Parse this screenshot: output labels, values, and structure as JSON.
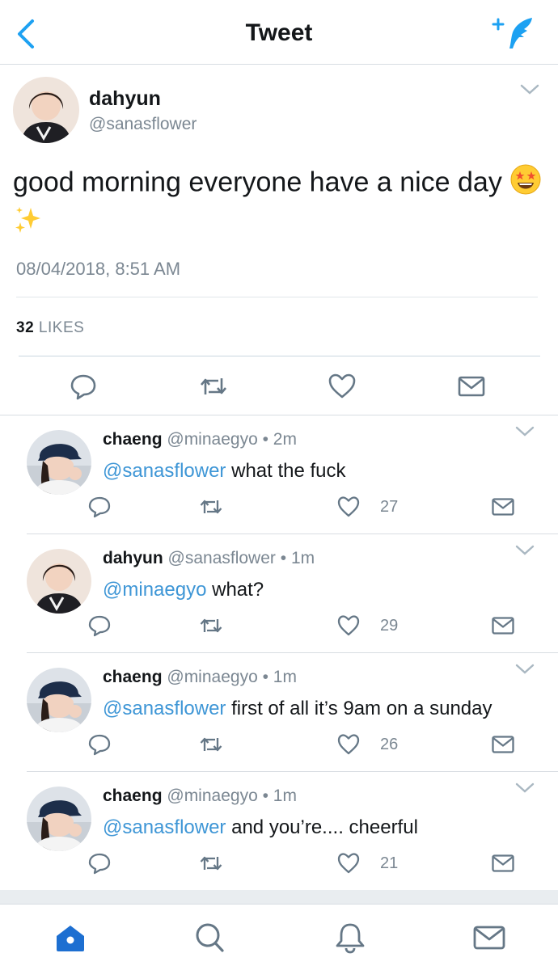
{
  "header": {
    "title": "Tweet"
  },
  "main_tweet": {
    "name": "dahyun",
    "handle": "@sanasflower",
    "text": "good morning everyone have a nice day",
    "emoji_1": "star-struck-emoji",
    "emoji_2": "sparkles-emoji",
    "timestamp": "08/04/2018, 8:51 AM",
    "likes_count": "32",
    "likes_label": "LIKES"
  },
  "replies": [
    {
      "name": "chaeng",
      "handle": "@minaegyo",
      "dot": "•",
      "time": "2m",
      "mention": "@sanasflower",
      "text": " what the fuck",
      "like_count": "27"
    },
    {
      "name": "dahyun",
      "handle": "@sanasflower",
      "dot": "•",
      "time": "1m",
      "mention": "@minaegyo",
      "text": " what?",
      "like_count": "29"
    },
    {
      "name": "chaeng",
      "handle": "@minaegyo",
      "dot": "•",
      "time": "1m",
      "mention": "@sanasflower",
      "text": " first of all it’s 9am on a sunday",
      "like_count": "26"
    },
    {
      "name": "chaeng",
      "handle": "@minaegyo",
      "dot": "•",
      "time": "1m",
      "mention": "@sanasflower",
      "text": " and you’re.... cheerful",
      "like_count": "21"
    }
  ],
  "tabs": [
    "home-icon",
    "search-icon",
    "notifications-icon",
    "messages-icon"
  ],
  "colors": {
    "accent": "#1da1f2",
    "mention": "#3e96d6",
    "icon_gray": "#657786"
  }
}
